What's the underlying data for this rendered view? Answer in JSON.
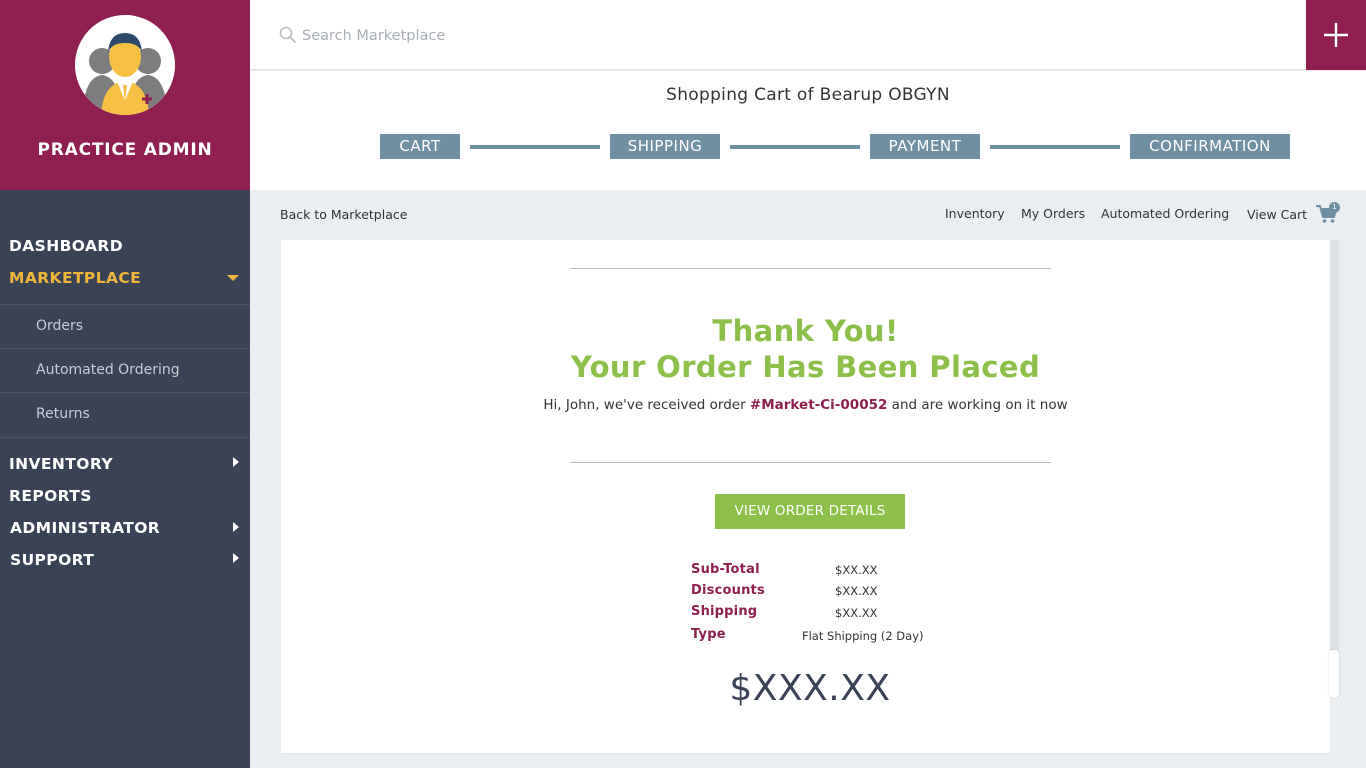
{
  "sidebar": {
    "role_title": "PRACTICE ADMIN",
    "nav": {
      "dashboard": "DASHBOARD",
      "marketplace": "MARKETPLACE",
      "marketplace_sub": [
        "Orders",
        "Automated Ordering",
        "Returns"
      ],
      "inventory": "INVENTORY",
      "reports": "REPORTS",
      "administrator": "ADMINISTRATOR",
      "support": "SUPPORT"
    }
  },
  "search": {
    "placeholder": "Search Marketplace"
  },
  "checkout": {
    "title": "Shopping Cart of Bearup OBGYN",
    "steps": [
      "CART",
      "SHIPPING",
      "PAYMENT",
      "CONFIRMATION"
    ]
  },
  "subnav": {
    "back": "Back to Marketplace",
    "links": [
      "Inventory",
      "My Orders",
      "Automated Ordering",
      "View Cart"
    ],
    "cart_count": "1"
  },
  "confirmation": {
    "heading_1": "Thank You!",
    "heading_2": "Your Order Has Been Placed",
    "message_prefix": "Hi, John, we've received order ",
    "order_number": "#Market-Ci-00052",
    "message_suffix": " and are working on it now",
    "button": "VIEW ORDER DETAILS",
    "summary": {
      "subtotal_label": "Sub-Total",
      "subtotal_value": "$XX.XX",
      "discounts_label": "Discounts",
      "discounts_value": "$XX.XX",
      "shipping_label": "Shipping",
      "shipping_value": "$XX.XX",
      "type_label": "Type",
      "type_value": "Flat Shipping (2 Day)"
    },
    "total": "$XXX.XX"
  },
  "icons": {
    "search": "search-icon",
    "add": "plus-icon",
    "cart": "cart-icon",
    "avatar": "user-avatar-icon"
  },
  "colors": {
    "brand": "#8e1f50",
    "sidebar": "#3a4356",
    "accent": "#f2b73a",
    "success": "#8cc04a",
    "step": "#6f8fa3"
  }
}
